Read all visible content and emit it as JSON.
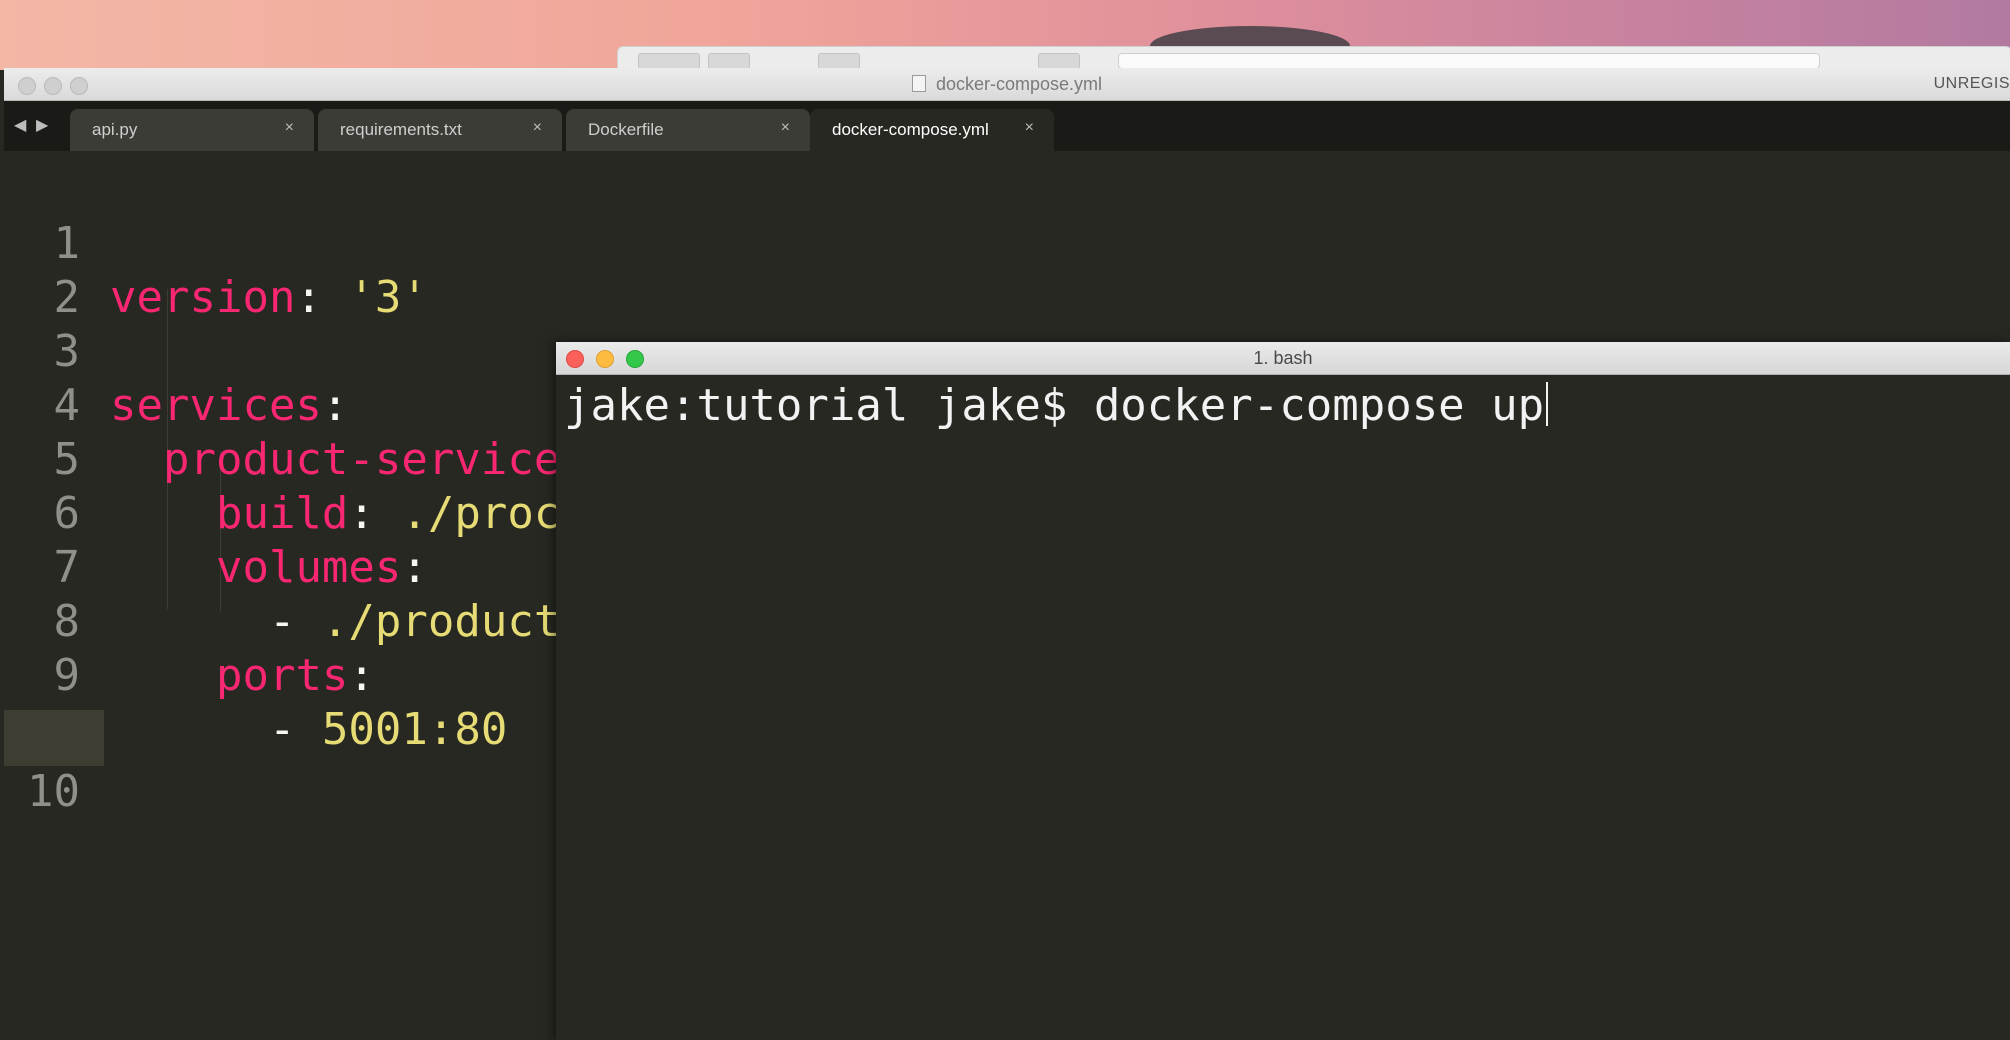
{
  "editor": {
    "title": "docker-compose.yml",
    "status": "UNREGIS",
    "tabs": [
      {
        "label": "api.py",
        "close": "×"
      },
      {
        "label": "requirements.txt",
        "close": "×"
      },
      {
        "label": "Dockerfile",
        "close": "×"
      },
      {
        "label": "docker-compose.yml",
        "close": "×",
        "active": true
      }
    ],
    "nav": {
      "back": "◀",
      "forward": "▶"
    },
    "lines": [
      {
        "num": "1",
        "key": "version",
        "punct": ": ",
        "value": "'3'"
      },
      {
        "num": "2"
      },
      {
        "num": "3",
        "key": "services",
        "punct": ":"
      },
      {
        "num": "4",
        "indent": "  ",
        "key": "product-service",
        "punct": ":"
      },
      {
        "num": "5",
        "indent": "    ",
        "key": "build",
        "punct": ": ",
        "value": "./proc"
      },
      {
        "num": "6",
        "indent": "    ",
        "key": "volumes",
        "punct": ":"
      },
      {
        "num": "7",
        "indent": "      ",
        "dash": "- ",
        "value": "./product"
      },
      {
        "num": "8",
        "indent": "    ",
        "key": "ports",
        "punct": ":"
      },
      {
        "num": "9",
        "indent": "      ",
        "dash": "- ",
        "value": "5001:80"
      },
      {
        "num": "10"
      }
    ]
  },
  "terminal": {
    "title": "1. bash",
    "prompt": "jake:tutorial jake$ ",
    "command": "docker-compose up"
  },
  "colors": {
    "background": "#272822",
    "keyword": "#f92672",
    "string": "#e6db74",
    "gutter": "#8f908a"
  }
}
